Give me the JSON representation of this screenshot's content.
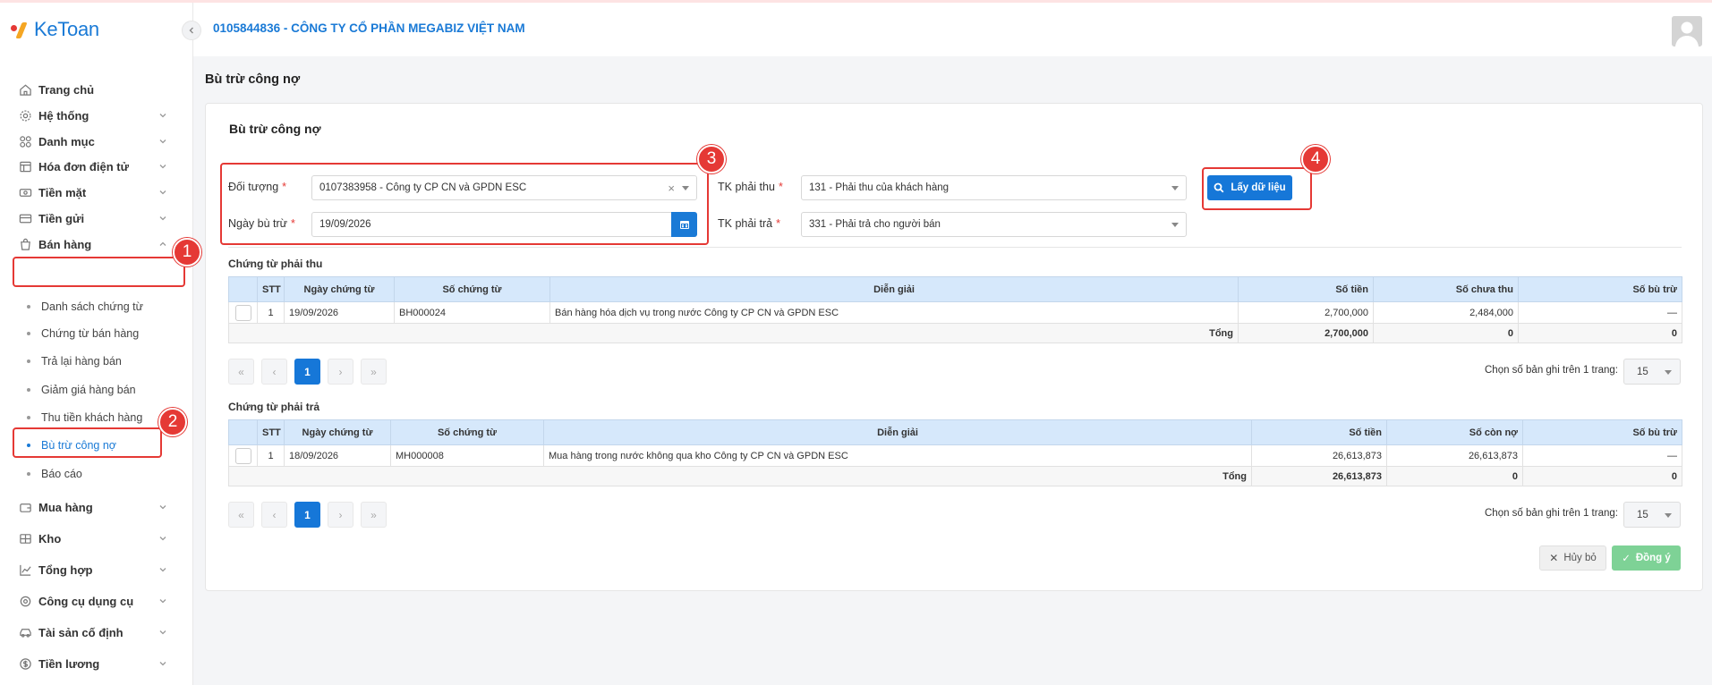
{
  "app": {
    "logo_text": "KeToan",
    "collapse_icon": "chevron-left-icon"
  },
  "header": {
    "company": "0105844836 - CÔNG TY CỔ PHẦN MEGABIZ VIỆT NAM"
  },
  "sidebar": {
    "items": [
      {
        "label": "Trang chủ",
        "icon": "home-icon"
      },
      {
        "label": "Hệ thống",
        "icon": "gear-icon"
      },
      {
        "label": "Danh mục",
        "icon": "grid-icon"
      },
      {
        "label": "Hóa đơn điện tử",
        "icon": "invoice-icon"
      },
      {
        "label": "Tiền mặt",
        "icon": "cash-icon"
      },
      {
        "label": "Tiền gửi",
        "icon": "card-icon"
      },
      {
        "label": "Bán hàng",
        "icon": "bag-icon"
      },
      {
        "label": "Mua hàng",
        "icon": "cart-icon"
      },
      {
        "label": "Kho",
        "icon": "warehouse-icon"
      },
      {
        "label": "Tổng hợp",
        "icon": "chart-icon"
      },
      {
        "label": "Công cụ dụng cụ",
        "icon": "tool-icon"
      },
      {
        "label": "Tài sản cố định",
        "icon": "car-icon"
      },
      {
        "label": "Tiền lương",
        "icon": "dollar-icon"
      }
    ],
    "ban_hang_sub": [
      {
        "label": "Danh sách chứng từ"
      },
      {
        "label": "Chứng từ bán hàng"
      },
      {
        "label": "Trả lại hàng bán"
      },
      {
        "label": "Giảm giá hàng bán"
      },
      {
        "label": "Thu tiền khách hàng"
      },
      {
        "label": "Bù trừ công nợ"
      },
      {
        "label": "Báo cáo"
      }
    ]
  },
  "page": {
    "title": "Bù trừ công nợ",
    "card_title": "Bù trừ công nợ"
  },
  "filters": {
    "doi_tuong_label": "Đối tượng",
    "doi_tuong_value": "0107383958 - Công ty CP CN và GPDN ESC",
    "ngay_label": "Ngày bù trừ",
    "ngay_value": "19/09/2026",
    "tk_thu_label": "TK phải thu",
    "tk_thu_value": "131 - Phải thu của khách hàng",
    "tk_tra_label": "TK phải trả",
    "tk_tra_value": "331 - Phải trả cho người bán",
    "required_mark": "*",
    "fetch_button": "Lấy dữ liệu"
  },
  "receivable": {
    "title": "Chứng từ phải thu",
    "headers": [
      "",
      "STT",
      "Ngày chứng từ",
      "Số chứng từ",
      "Diễn giải",
      "Số tiền",
      "Số chưa thu",
      "Số bù trừ"
    ],
    "rows": [
      {
        "stt": "1",
        "date": "19/09/2026",
        "doc": "BH000024",
        "desc": "Bán hàng hóa dịch vụ trong nước Công ty CP CN và GPDN ESC",
        "amount": "2,700,000",
        "remaining": "2,484,000",
        "offset": "—"
      }
    ],
    "total_label": "Tổng",
    "total_amount": "2,700,000",
    "total_remaining": "0",
    "total_offset": "0"
  },
  "payable": {
    "title": "Chứng từ phải trả",
    "headers": [
      "",
      "STT",
      "Ngày chứng từ",
      "Số chứng từ",
      "Diễn giải",
      "Số tiền",
      "Số còn nợ",
      "Số bù trừ"
    ],
    "rows": [
      {
        "stt": "1",
        "date": "18/09/2026",
        "doc": "MH000008",
        "desc": "Mua hàng trong nước không qua kho Công ty CP CN và GPDN ESC",
        "amount": "26,613,873",
        "remaining": "26,613,873",
        "offset": "—"
      }
    ],
    "total_label": "Tổng",
    "total_amount": "26,613,873",
    "total_remaining": "0",
    "total_offset": "0"
  },
  "pagination": {
    "first": "«",
    "prev": "‹",
    "current": "1",
    "next": "›",
    "last": "»",
    "page_size_label": "Chọn số bản ghi trên 1 trang:",
    "page_size": "15"
  },
  "actions": {
    "cancel": "Hủy bỏ",
    "ok": "Đồng ý"
  },
  "annotations": [
    "1",
    "2",
    "3",
    "4"
  ],
  "colors": {
    "primary": "#1677d8",
    "annotation": "#e53935",
    "header_blue": "#d6e8fb",
    "ok_green": "#7ed296"
  }
}
